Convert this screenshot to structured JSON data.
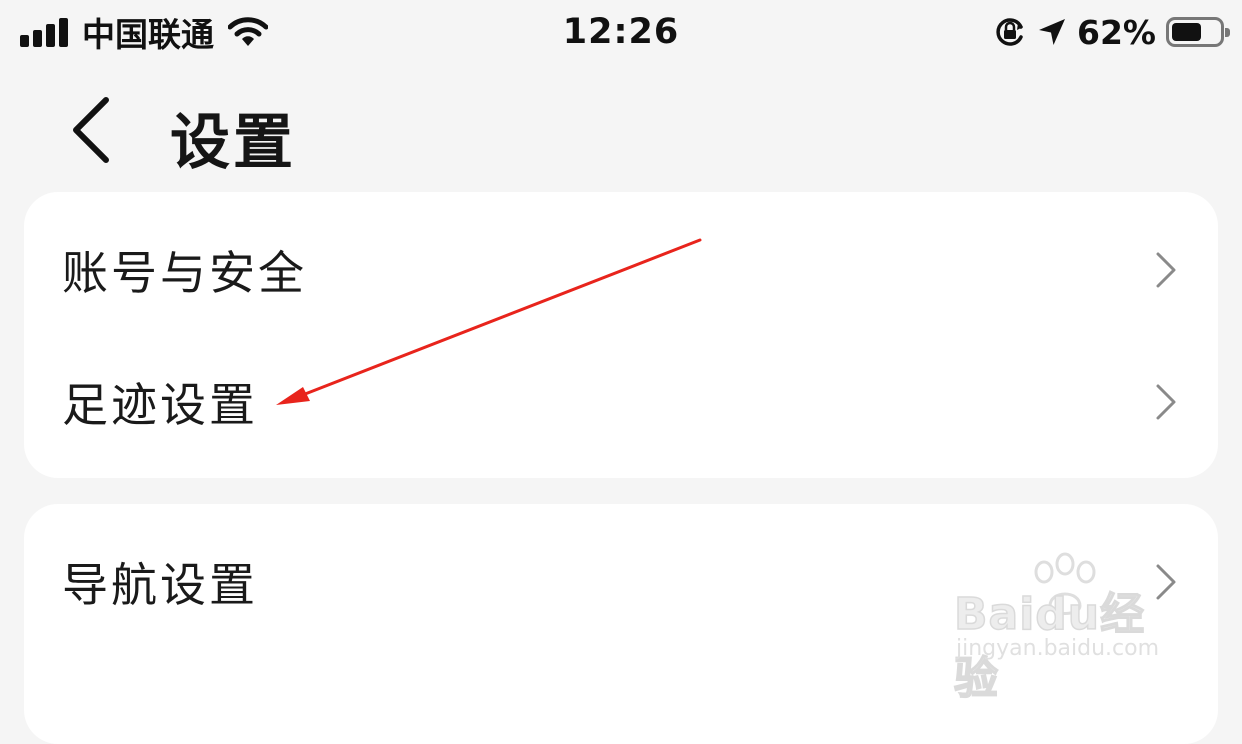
{
  "status_bar": {
    "carrier": "中国联通",
    "time": "12:26",
    "battery_percent": "62%",
    "battery_level": 0.62,
    "icons": [
      "signal-icon",
      "wifi-icon",
      "orientation-lock-icon",
      "location-arrow-icon",
      "battery-icon"
    ]
  },
  "header": {
    "title": "设置",
    "back_icon": "back-chevron-icon"
  },
  "settings": {
    "group1": [
      {
        "label": "账号与安全",
        "icon": "chevron-right-icon"
      },
      {
        "label": "足迹设置",
        "icon": "chevron-right-icon"
      }
    ],
    "group2": [
      {
        "label": "导航设置",
        "icon": "chevron-right-icon"
      }
    ]
  },
  "annotation": {
    "type": "arrow",
    "color": "#e8241c"
  },
  "watermark": {
    "brand": "Baidu经验",
    "url": "jingyan.baidu.com"
  },
  "colors": {
    "background": "#f5f5f5",
    "card": "#ffffff",
    "text": "#1a1a1a",
    "chevron": "#8a8a8a"
  }
}
